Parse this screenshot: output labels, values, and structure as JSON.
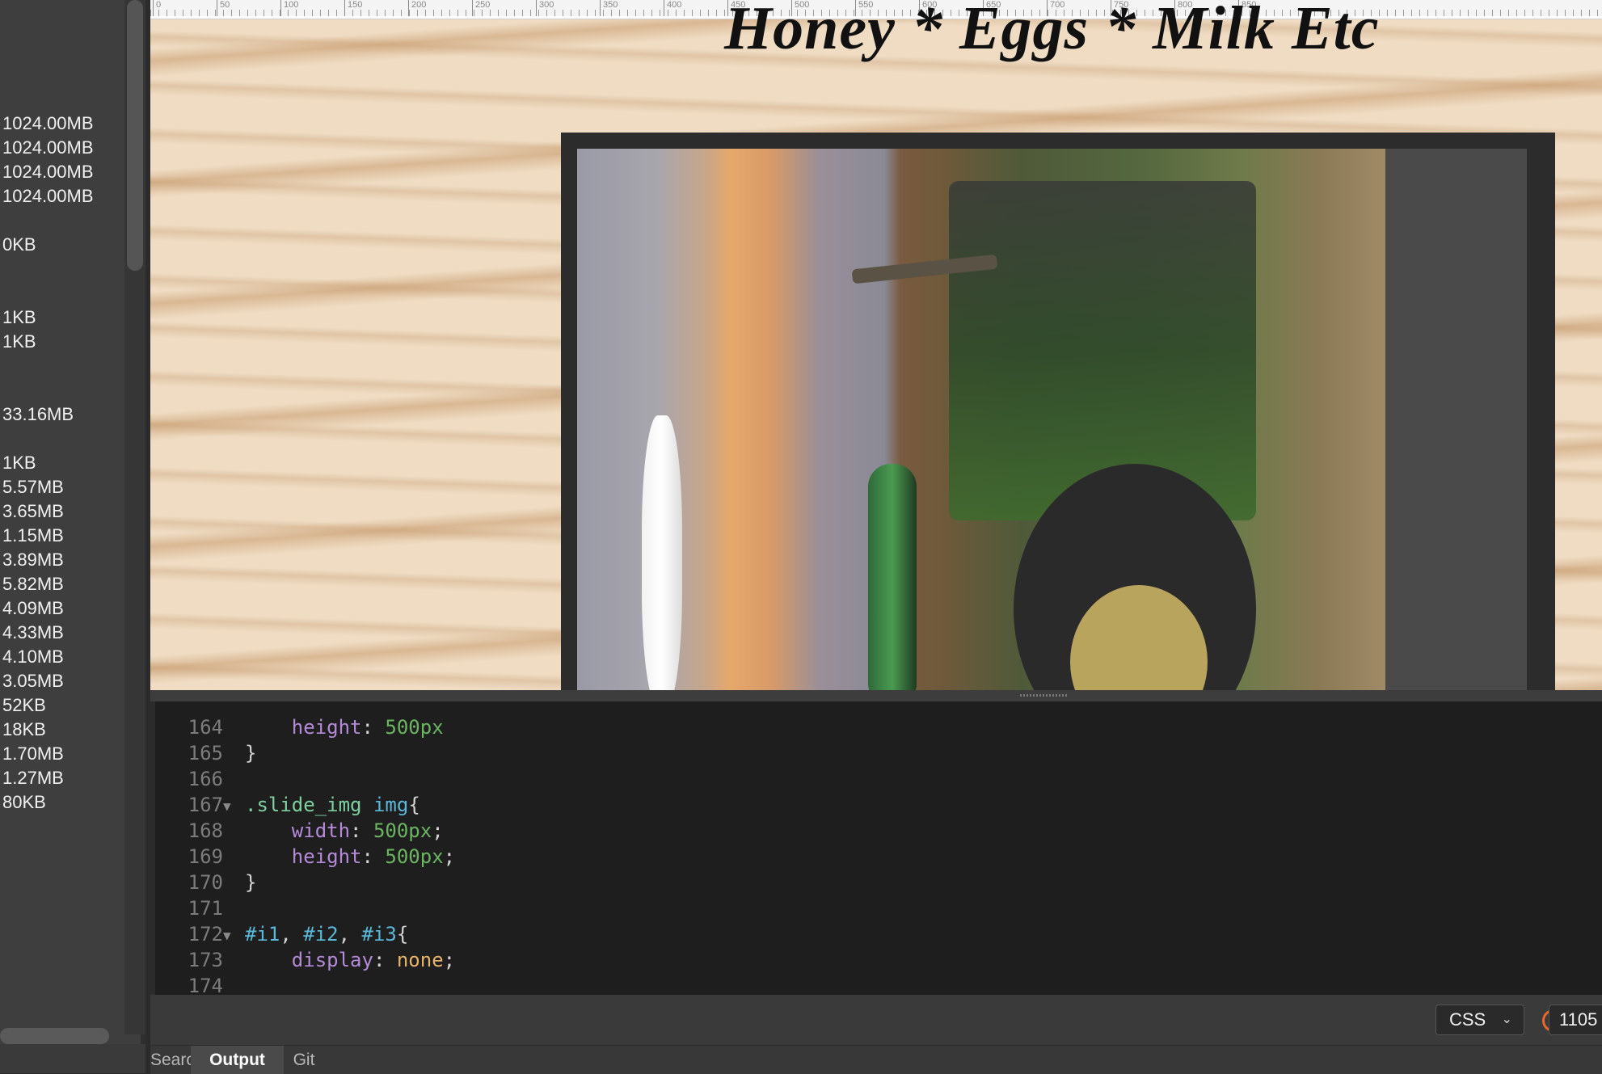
{
  "left_panel": {
    "sizes": [
      "1024.00MB",
      "1024.00MB",
      "1024.00MB",
      "1024.00MB",
      "0KB",
      "1KB",
      "1KB",
      "33.16MB",
      "1KB",
      "5.57MB",
      "3.65MB",
      "1.15MB",
      "3.89MB",
      "5.82MB",
      "4.09MB",
      "4.33MB",
      "4.10MB",
      "3.05MB",
      "52KB",
      "18KB",
      "1.70MB",
      "1.27MB",
      "80KB"
    ]
  },
  "preview": {
    "site_title": "Honey * Eggs * Milk Etc",
    "ruler_labels": [
      "0",
      "50",
      "100",
      "150",
      "200",
      "250",
      "300",
      "350",
      "400",
      "450",
      "500",
      "550",
      "600",
      "650",
      "700",
      "750",
      "800",
      "850"
    ]
  },
  "editor": {
    "lines": [
      {
        "num": "164",
        "fold": "",
        "tokens": [
          {
            "t": "    ",
            "c": "punc"
          },
          {
            "t": "height",
            "c": "prop"
          },
          {
            "t": ": ",
            "c": "punc"
          },
          {
            "t": "500px",
            "c": "val"
          }
        ]
      },
      {
        "num": "165",
        "fold": "",
        "tokens": [
          {
            "t": "}",
            "c": "punc"
          }
        ]
      },
      {
        "num": "166",
        "fold": "",
        "tokens": []
      },
      {
        "num": "167",
        "fold": "▼",
        "tokens": [
          {
            "t": ".slide_img",
            "c": "sel"
          },
          {
            "t": " ",
            "c": "punc"
          },
          {
            "t": "img",
            "c": "tag"
          },
          {
            "t": "{",
            "c": "punc"
          }
        ]
      },
      {
        "num": "168",
        "fold": "",
        "tokens": [
          {
            "t": "    ",
            "c": "punc"
          },
          {
            "t": "width",
            "c": "prop"
          },
          {
            "t": ": ",
            "c": "punc"
          },
          {
            "t": "500px",
            "c": "val"
          },
          {
            "t": ";",
            "c": "punc"
          }
        ]
      },
      {
        "num": "169",
        "fold": "",
        "tokens": [
          {
            "t": "    ",
            "c": "punc"
          },
          {
            "t": "height",
            "c": "prop"
          },
          {
            "t": ": ",
            "c": "punc"
          },
          {
            "t": "500px",
            "c": "val"
          },
          {
            "t": ";",
            "c": "punc"
          }
        ]
      },
      {
        "num": "170",
        "fold": "",
        "tokens": [
          {
            "t": "}",
            "c": "punc"
          }
        ]
      },
      {
        "num": "171",
        "fold": "",
        "tokens": []
      },
      {
        "num": "172",
        "fold": "▼",
        "tokens": [
          {
            "t": "#i1",
            "c": "id"
          },
          {
            "t": ", ",
            "c": "punc"
          },
          {
            "t": "#i2",
            "c": "id"
          },
          {
            "t": ", ",
            "c": "punc"
          },
          {
            "t": "#i3",
            "c": "id"
          },
          {
            "t": "{",
            "c": "punc"
          }
        ]
      },
      {
        "num": "173",
        "fold": "",
        "tokens": [
          {
            "t": "    ",
            "c": "punc"
          },
          {
            "t": "display",
            "c": "prop"
          },
          {
            "t": ": ",
            "c": "punc"
          },
          {
            "t": "none",
            "c": "kw"
          },
          {
            "t": ";",
            "c": "punc"
          }
        ]
      },
      {
        "num": "174",
        "fold": "",
        "tokens": []
      }
    ]
  },
  "status_bar": {
    "warning_icon": "warning-icon",
    "language": "CSS",
    "position": "1105"
  },
  "tabs": [
    {
      "label": "Search",
      "active": false
    },
    {
      "label": "Output",
      "active": true
    },
    {
      "label": "Git",
      "active": false
    }
  ],
  "colors": {
    "warning": "#e8692c",
    "editor_bg": "#1e1e1e",
    "panel_bg": "#3e3e3e"
  }
}
